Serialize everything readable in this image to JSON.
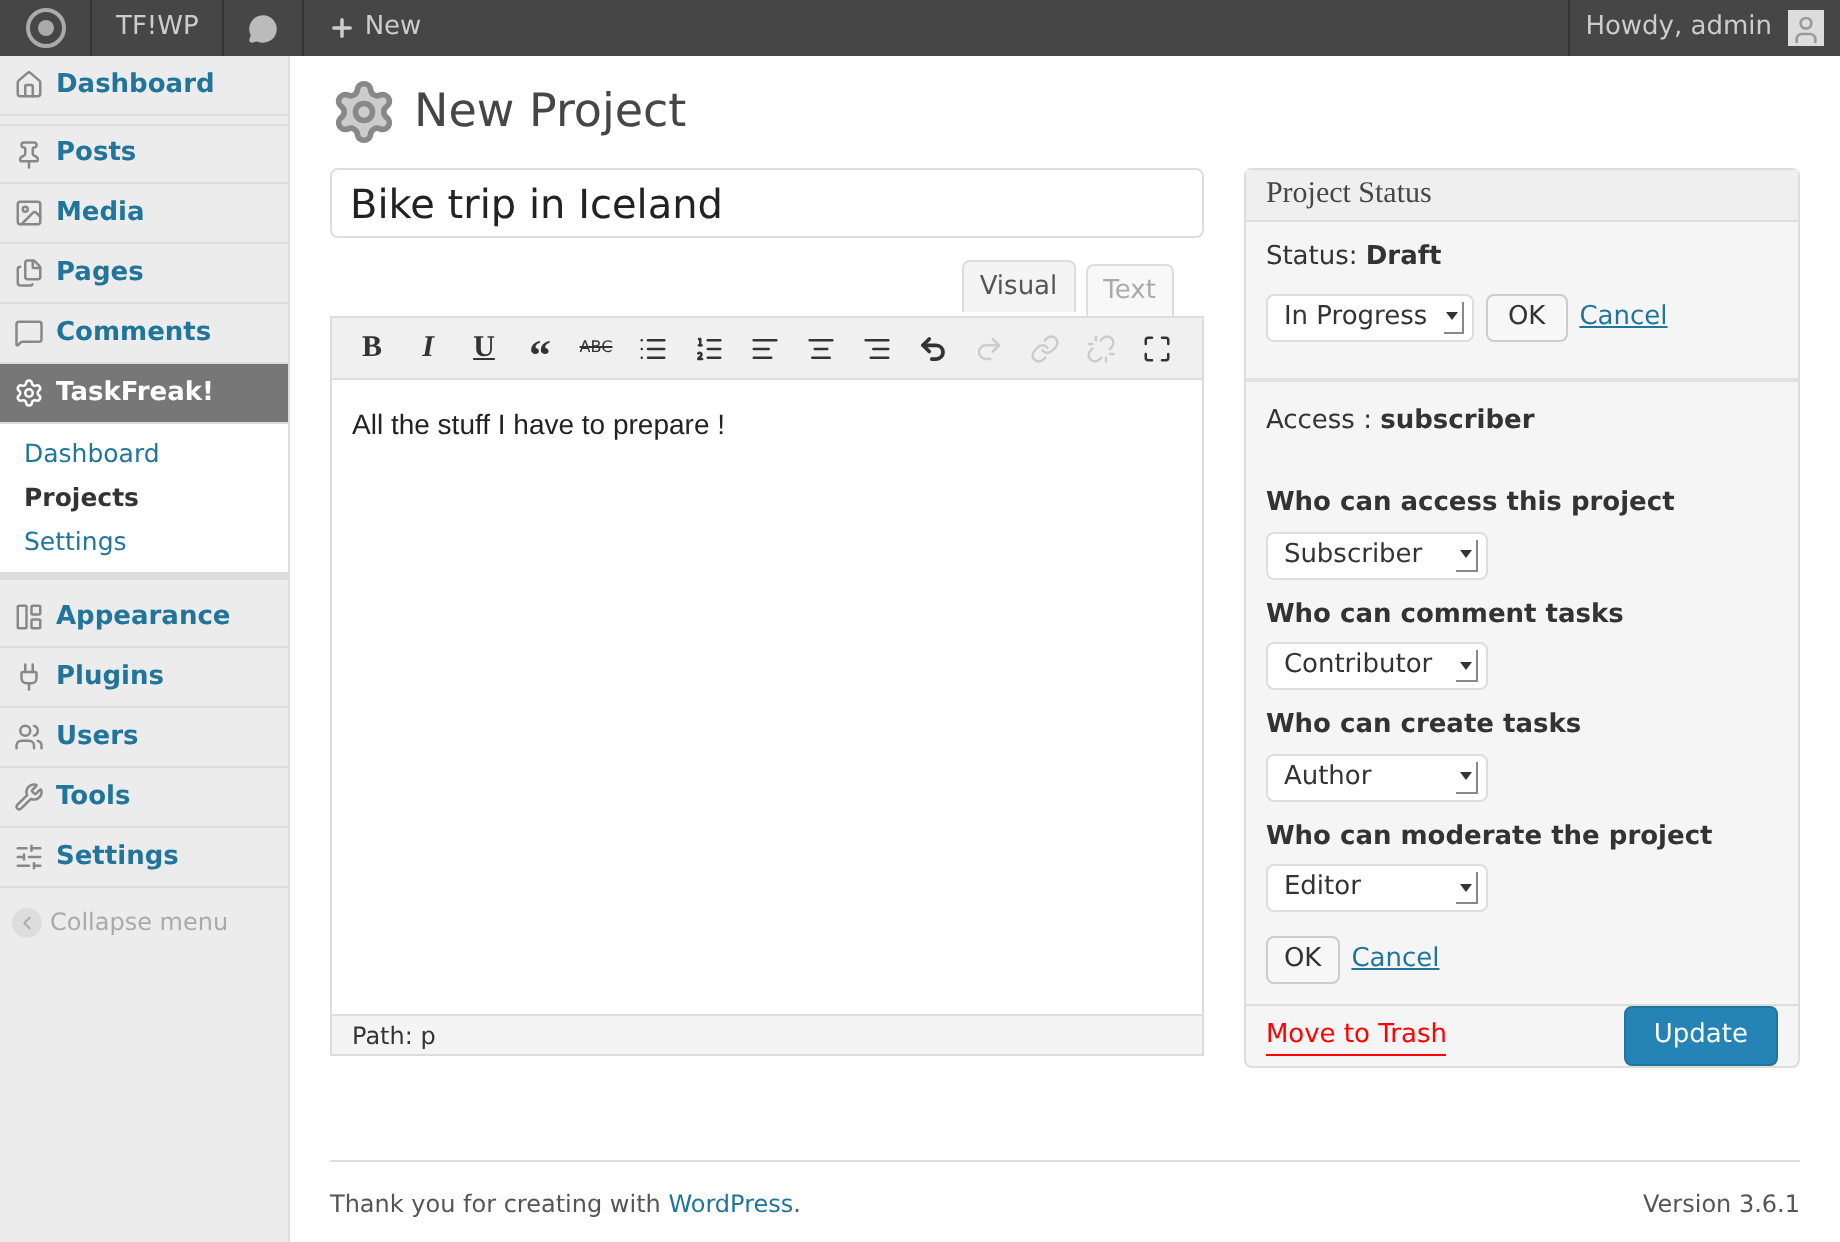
{
  "admin_bar": {
    "site": "TF!WP",
    "new": "New",
    "greeting": "Howdy, admin"
  },
  "sidebar": {
    "items": [
      {
        "label": "Dashboard",
        "selected": false
      },
      {
        "label": "Posts",
        "selected": false
      },
      {
        "label": "Media",
        "selected": false
      },
      {
        "label": "Pages",
        "selected": false
      },
      {
        "label": "Comments",
        "selected": false
      },
      {
        "label": "TaskFreak!",
        "selected": true,
        "children": [
          {
            "label": "Dashboard",
            "selected": false
          },
          {
            "label": "Projects",
            "selected": true
          },
          {
            "label": "Settings",
            "selected": false
          }
        ]
      },
      {
        "label": "Appearance",
        "selected": false
      },
      {
        "label": "Plugins",
        "selected": false
      },
      {
        "label": "Users",
        "selected": false
      },
      {
        "label": "Tools",
        "selected": false
      },
      {
        "label": "Settings",
        "selected": false
      }
    ],
    "collapse": "Collapse menu"
  },
  "page": {
    "title": "New Project",
    "project_title": "Bike trip in Iceland"
  },
  "editor": {
    "tabs": [
      {
        "label": "Visual",
        "selected": true
      },
      {
        "label": "Text",
        "selected": false
      }
    ],
    "toolbar": [
      {
        "kind": "bold",
        "label": "B",
        "disabled": false
      },
      {
        "kind": "italic",
        "label": "I",
        "disabled": false
      },
      {
        "kind": "underline",
        "label": "U",
        "disabled": false
      },
      {
        "kind": "quote",
        "label": "“",
        "disabled": false
      },
      {
        "kind": "strike",
        "label": "ABC",
        "disabled": false
      },
      {
        "kind": "bullets",
        "disabled": false
      },
      {
        "kind": "numbers",
        "disabled": false
      },
      {
        "kind": "align_left",
        "disabled": false
      },
      {
        "kind": "align_center",
        "disabled": false
      },
      {
        "kind": "align_right",
        "disabled": false
      },
      {
        "kind": "undo",
        "disabled": false
      },
      {
        "kind": "redo",
        "disabled": true
      },
      {
        "kind": "link",
        "disabled": true
      },
      {
        "kind": "unlink",
        "disabled": true
      },
      {
        "kind": "fullscreen",
        "disabled": false
      }
    ],
    "content": "All the stuff I have to prepare !",
    "path": "Path: p"
  },
  "status_box": {
    "title": "Project Status",
    "status_label": "Status:",
    "status_value": "Draft",
    "status_select": "In Progress",
    "ok": "OK",
    "cancel": "Cancel",
    "access_label": "Access :",
    "access_value": "subscriber",
    "permissions": [
      {
        "label": "Who can access this project",
        "value": "Subscriber"
      },
      {
        "label": "Who can comment tasks",
        "value": "Contributor"
      },
      {
        "label": "Who can create tasks",
        "value": "Author"
      },
      {
        "label": "Who can moderate the project",
        "value": "Editor"
      }
    ],
    "access_ok": "OK",
    "access_cancel": "Cancel",
    "trash": "Move to Trash",
    "update": "Update"
  },
  "footer": {
    "thanks": "Thank you for creating with",
    "link": "WordPress",
    "period": ".",
    "version": "Version 3.6.1"
  }
}
